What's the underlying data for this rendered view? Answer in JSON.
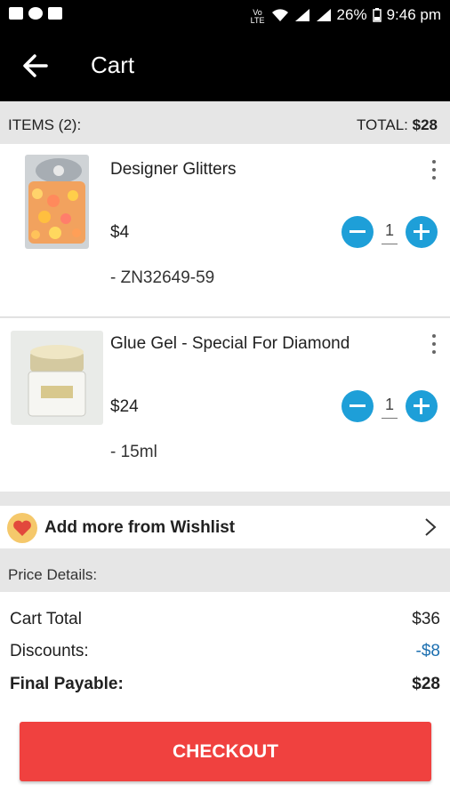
{
  "status_bar": {
    "battery": "26%",
    "time": "9:46 pm"
  },
  "app_bar": {
    "title": "Cart"
  },
  "summary": {
    "items_label": "ITEMS (2):",
    "total_label": "TOTAL:",
    "total_value": "$28"
  },
  "items": [
    {
      "name": "Designer Glitters",
      "price": "$4",
      "variant": "- ZN32649-59",
      "quantity": "1"
    },
    {
      "name": "Glue Gel - Special For Diamond",
      "price": "$24",
      "variant": "- 15ml",
      "quantity": "1"
    }
  ],
  "wishlist": {
    "label": "Add more from Wishlist"
  },
  "price_details": {
    "heading": "Price Details:",
    "cart_total_label": "Cart Total",
    "cart_total_value": "$36",
    "discounts_label": "Discounts:",
    "discounts_value": "-$8",
    "final_label": "Final Payable:",
    "final_value": "$28"
  },
  "checkout": {
    "label": "CHECKOUT"
  },
  "colors": {
    "accent_blue": "#1e9fd8",
    "checkout_red": "#f0413f",
    "discount_blue": "#1c6fb0",
    "app_bar": "#000000"
  }
}
